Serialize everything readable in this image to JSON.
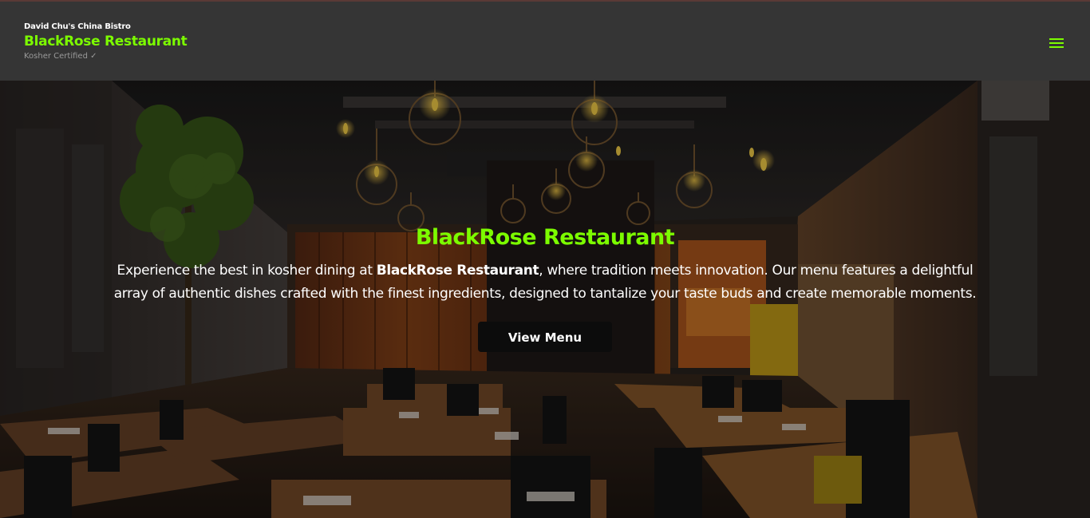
{
  "header": {
    "pretitle": "David Chu's China Bistro",
    "title": "BlackRose Restaurant",
    "subtitle": "Kosher Certified ✓",
    "menu_icon": "hamburger-menu-icon"
  },
  "hero": {
    "title": "BlackRose Restaurant",
    "text_before": "Experience the best in kosher dining at ",
    "text_bold": "BlackRose Restaurant",
    "text_after": ", where tradition meets innovation. Our menu features a delightful array of authentic dishes crafted with the finest ingredients, designed to tantalize your taste buds and create memorable moments.",
    "button_label": "View Menu"
  },
  "colors": {
    "accent": "#7cfc00",
    "header_bg": "#353535",
    "button_bg": "#0c0c0c"
  }
}
